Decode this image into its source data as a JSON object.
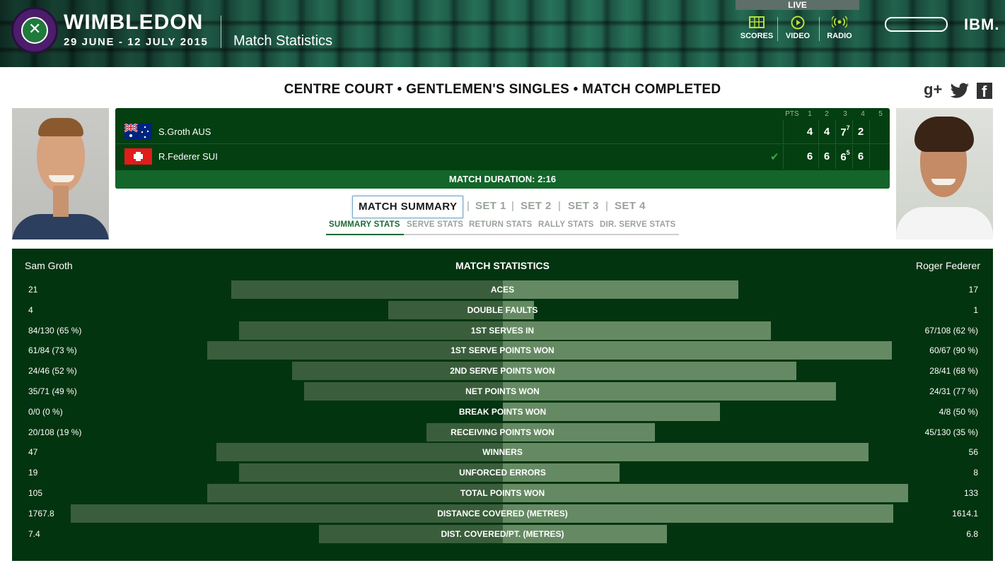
{
  "header": {
    "brand": "WIMBLEDON",
    "dates": "29 JUNE - 12 JULY 2015",
    "section": "Match Statistics",
    "logo_text": "THE CHAMPIONSHIPS WIMBLEDON",
    "live": "LIVE",
    "nav": [
      {
        "label": "SCORES",
        "icon": "scores-icon"
      },
      {
        "label": "VIDEO",
        "icon": "play-icon"
      },
      {
        "label": "RADIO",
        "icon": "radio-icon"
      }
    ],
    "sponsor": "IBM."
  },
  "court_title": "CENTRE COURT • GENTLEMEN'S SINGLES • MATCH COMPLETED",
  "social": [
    "g+",
    "twitter",
    "facebook"
  ],
  "scoreboard": {
    "headers": [
      "PTS",
      "1",
      "2",
      "3",
      "4",
      "5"
    ],
    "players": [
      {
        "name": "S.Groth AUS",
        "country": "AUS",
        "sets": [
          "4",
          "4",
          "7",
          "2"
        ],
        "tiebreak": {
          "set": 3,
          "value": "7"
        },
        "winner": false
      },
      {
        "name": "R.Federer SUI",
        "country": "SUI",
        "sets": [
          "6",
          "6",
          "6",
          "6"
        ],
        "tiebreak": {
          "set": 3,
          "value": "5"
        },
        "winner": true
      }
    ],
    "duration": "MATCH DURATION: 2:16"
  },
  "tabs": [
    "MATCH SUMMARY",
    "SET 1",
    "SET 2",
    "SET 3",
    "SET 4"
  ],
  "subtabs": [
    "SUMMARY STATS",
    "SERVE STATS",
    "RETURN STATS",
    "RALLY STATS",
    "DIR. SERVE STATS"
  ],
  "stats": {
    "title": "MATCH STATISTICS",
    "player_left": "Sam Groth",
    "player_right": "Roger Federer",
    "rows": [
      {
        "label": "ACES",
        "left": "21",
        "right": "17",
        "lfrac": 0.554,
        "rfrac": 0.48
      },
      {
        "label": "DOUBLE FAULTS",
        "left": "4",
        "right": "1",
        "lfrac": 0.234,
        "rfrac": 0.064
      },
      {
        "label": "1ST SERVES IN",
        "left": "84/130 (65 %)",
        "right": "67/108 (62 %)",
        "lfrac": 0.538,
        "rfrac": 0.546
      },
      {
        "label": "1ST SERVE POINTS WON",
        "left": "61/84 (73 %)",
        "right": "60/67 (90 %)",
        "lfrac": 0.603,
        "rfrac": 0.793
      },
      {
        "label": "2ND SERVE POINTS WON",
        "left": "24/46 (52 %)",
        "right": "28/41 (68 %)",
        "lfrac": 0.43,
        "rfrac": 0.598
      },
      {
        "label": "NET POINTS WON",
        "left": "35/71 (49 %)",
        "right": "24/31 (77 %)",
        "lfrac": 0.405,
        "rfrac": 0.678
      },
      {
        "label": "BREAK POINTS WON",
        "left": "0/0 (0 %)",
        "right": "4/8 (50 %)",
        "lfrac": 0.0,
        "rfrac": 0.442
      },
      {
        "label": "RECEIVING POINTS WON",
        "left": "20/108 (19 %)",
        "right": "45/130 (35 %)",
        "lfrac": 0.156,
        "rfrac": 0.31
      },
      {
        "label": "WINNERS",
        "left": "47",
        "right": "56",
        "lfrac": 0.584,
        "rfrac": 0.745
      },
      {
        "label": "UNFORCED ERRORS",
        "left": "19",
        "right": "8",
        "lfrac": 0.538,
        "rfrac": 0.238
      },
      {
        "label": "TOTAL POINTS WON",
        "left": "105",
        "right": "133",
        "lfrac": 0.603,
        "rfrac": 0.825
      },
      {
        "label": "DISTANCE COVERED (METRES)",
        "left": "1767.8",
        "right": "1614.1",
        "lfrac": 0.88,
        "rfrac": 0.796
      },
      {
        "label": "DIST. COVERED/PT. (METRES)",
        "left": "7.4",
        "right": "6.8",
        "lfrac": 0.374,
        "rfrac": 0.334
      }
    ]
  }
}
